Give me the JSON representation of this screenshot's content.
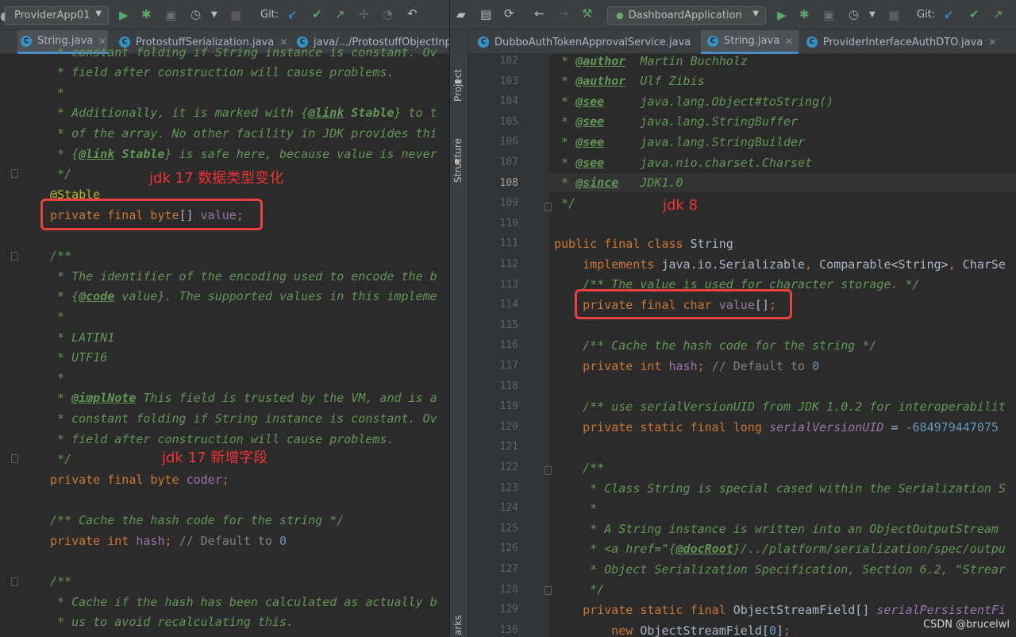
{
  "left": {
    "run_config": "ProviderApp01",
    "git_label": "Git:",
    "tabs": [
      "String.java",
      "ProtostuffSerialization.java",
      "java/.../ProtostuffObjectInpu"
    ],
    "note_type_change": "jdk 17 数据类型变化",
    "note_new_field": "jdk 17 新增字段"
  },
  "right": {
    "run_config": "DashboardApplication",
    "git_label": "Git:",
    "sidebar_project": "Project",
    "sidebar_structure": "Structure",
    "sidebar_bookmarks": "arks",
    "tabs": [
      "DubboAuthTokenApprovalService.java",
      "String.java",
      "ProviderInterfaceAuthDTO.java"
    ],
    "line_numbers": [
      "102",
      "103",
      "104",
      "105",
      "106",
      "107",
      "108",
      "109",
      "110",
      "111",
      "112",
      "113",
      "114",
      "115",
      "116",
      "117",
      "118",
      "119",
      "120",
      "121",
      "122",
      "123",
      "124",
      "125",
      "126",
      "127",
      "128",
      "129",
      "130"
    ],
    "note_jdk8": "jdk 8"
  },
  "watermark": "CSDN @brucelwl"
}
